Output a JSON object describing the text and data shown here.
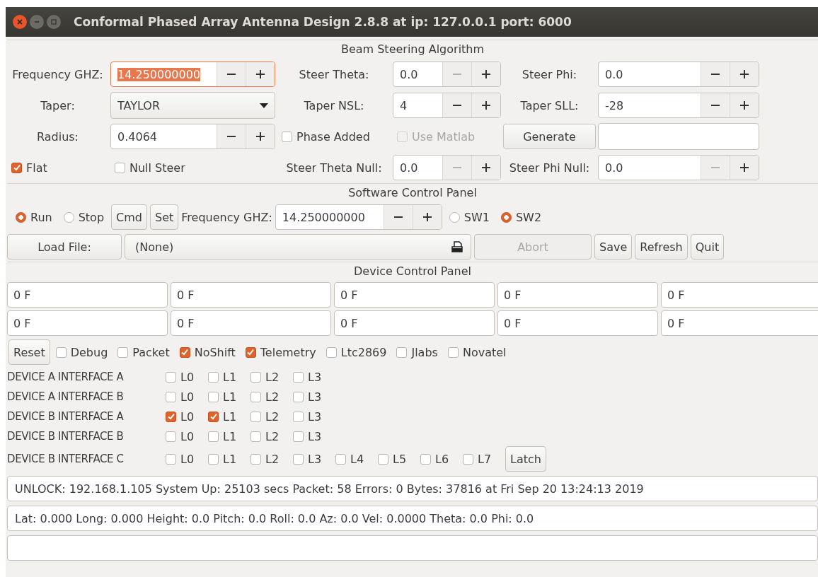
{
  "window": {
    "title": "Conformal Phased Array Antenna Design 2.8.8 at ip: 127.0.0.1 port: 6000"
  },
  "beam_steering": {
    "title": "Beam Steering Algorithm",
    "rows": [
      {
        "items": [
          {
            "kind": "label",
            "text": "Frequency GHZ:"
          },
          {
            "kind": "spin",
            "value": "14.250000000",
            "minus_disabled": false,
            "focused": true
          },
          {
            "kind": "label",
            "text": "Steer Theta:"
          },
          {
            "kind": "spin",
            "value": "0.0",
            "minus_disabled": true,
            "focused": false
          },
          {
            "kind": "label",
            "text": "Steer Phi:"
          },
          {
            "kind": "spin",
            "value": "0.0",
            "minus_disabled": false,
            "focused": false
          }
        ]
      },
      {
        "items": [
          {
            "kind": "label",
            "text": "Taper:"
          },
          {
            "kind": "combo",
            "value": "TAYLOR"
          },
          {
            "kind": "label",
            "text": "Taper NSL:"
          },
          {
            "kind": "spin",
            "value": "4",
            "minus_disabled": false,
            "focused": false
          },
          {
            "kind": "label",
            "text": "Taper SLL:"
          },
          {
            "kind": "spin",
            "value": "-28",
            "minus_disabled": false,
            "focused": false
          }
        ]
      },
      {
        "items": [
          {
            "kind": "label",
            "text": "Radius:"
          },
          {
            "kind": "spin",
            "value": "0.4064",
            "minus_disabled": false,
            "focused": false
          },
          {
            "kind": "check",
            "label": "Phase Added",
            "checked": false,
            "disabled": false
          },
          {
            "kind": "check",
            "label": "Use Matlab",
            "checked": false,
            "disabled": true
          },
          {
            "kind": "button",
            "label": "Generate",
            "disabled": false
          },
          {
            "kind": "entry"
          }
        ]
      },
      {
        "items": [
          {
            "kind": "check",
            "label": "Flat",
            "checked": true,
            "disabled": false
          },
          {
            "kind": "check",
            "label": "Null Steer",
            "checked": false,
            "disabled": false
          },
          {
            "kind": "label",
            "text": "Steer Theta Null:"
          },
          {
            "kind": "spin",
            "value": "0.0",
            "minus_disabled": true,
            "focused": false
          },
          {
            "kind": "label",
            "text": "Steer Phi Null:"
          },
          {
            "kind": "spin",
            "value": "0.0",
            "minus_disabled": true,
            "focused": false
          }
        ]
      }
    ]
  },
  "software_control": {
    "title": "Software Control Panel",
    "rows": [
      {
        "items": [
          {
            "kind": "radio",
            "label": "Run",
            "selected": true
          },
          {
            "kind": "radio",
            "label": "Stop",
            "selected": false
          },
          {
            "kind": "button",
            "label": "Cmd",
            "disabled": false
          },
          {
            "kind": "button",
            "label": "Set",
            "disabled": false
          },
          {
            "kind": "label",
            "text": "Frequency GHZ:"
          },
          {
            "kind": "spin",
            "value": "14.250000000",
            "minus_disabled": false,
            "focused": false
          },
          {
            "kind": "radio",
            "label": "SW1",
            "selected": false
          },
          {
            "kind": "radio",
            "label": "SW2",
            "selected": true
          }
        ]
      },
      {
        "items": [
          {
            "kind": "button",
            "label": "Load File:",
            "disabled": false
          },
          {
            "kind": "file",
            "value": "(None)"
          },
          {
            "kind": "button",
            "label": "Abort",
            "disabled": true
          },
          {
            "kind": "button",
            "label": "Save",
            "disabled": false
          },
          {
            "kind": "button",
            "label": "Refresh",
            "disabled": false
          },
          {
            "kind": "button",
            "label": "Quit",
            "disabled": false
          }
        ]
      }
    ]
  },
  "device_control": {
    "title": "Device Control Panel",
    "rows": [
      {
        "items": [
          {
            "kind": "entry",
            "value": "0 F"
          },
          {
            "kind": "entry",
            "value": "0 F"
          },
          {
            "kind": "entry",
            "value": "0 F"
          },
          {
            "kind": "entry",
            "value": "0 F"
          },
          {
            "kind": "entry",
            "value": "0 F"
          }
        ]
      },
      {
        "items": [
          {
            "kind": "entry",
            "value": "0 F"
          },
          {
            "kind": "entry",
            "value": "0 F"
          },
          {
            "kind": "entry",
            "value": "0 F"
          },
          {
            "kind": "entry",
            "value": "0 F"
          },
          {
            "kind": "entry",
            "value": "0 F"
          }
        ]
      },
      {
        "items": [
          {
            "kind": "button",
            "label": "Reset",
            "disabled": false
          },
          {
            "kind": "check",
            "label": "Debug",
            "checked": false
          },
          {
            "kind": "check",
            "label": "Packet",
            "checked": false
          },
          {
            "kind": "check",
            "label": "NoShift",
            "checked": true
          },
          {
            "kind": "check",
            "label": "Telemetry",
            "checked": true
          },
          {
            "kind": "check",
            "label": "Ltc2869",
            "checked": false
          },
          {
            "kind": "check",
            "label": "Jlabs",
            "checked": false
          },
          {
            "kind": "check",
            "label": "Novatel",
            "checked": false
          }
        ]
      },
      {
        "items": [
          {
            "kind": "label",
            "text": "DEVICE A INTERFACE A"
          },
          {
            "kind": "check",
            "label": "L0",
            "checked": false
          },
          {
            "kind": "check",
            "label": "L1",
            "checked": false
          },
          {
            "kind": "check",
            "label": "L2",
            "checked": false
          },
          {
            "kind": "check",
            "label": "L3",
            "checked": false
          }
        ]
      },
      {
        "items": [
          {
            "kind": "label",
            "text": "DEVICE A INTERFACE B"
          },
          {
            "kind": "check",
            "label": "L0",
            "checked": false
          },
          {
            "kind": "check",
            "label": "L1",
            "checked": false
          },
          {
            "kind": "check",
            "label": "L2",
            "checked": false
          },
          {
            "kind": "check",
            "label": "L3",
            "checked": false
          }
        ]
      },
      {
        "items": [
          {
            "kind": "label",
            "text": "DEVICE B INTERFACE A"
          },
          {
            "kind": "check",
            "label": "L0",
            "checked": true
          },
          {
            "kind": "check",
            "label": "L1",
            "checked": true
          },
          {
            "kind": "check",
            "label": "L2",
            "checked": false
          },
          {
            "kind": "check",
            "label": "L3",
            "checked": false
          }
        ]
      },
      {
        "items": [
          {
            "kind": "label",
            "text": "DEVICE B INTERFACE B"
          },
          {
            "kind": "check",
            "label": "L0",
            "checked": false
          },
          {
            "kind": "check",
            "label": "L1",
            "checked": false
          },
          {
            "kind": "check",
            "label": "L2",
            "checked": false
          },
          {
            "kind": "check",
            "label": "L3",
            "checked": false
          }
        ]
      },
      {
        "items": [
          {
            "kind": "label",
            "text": "DEVICE B INTERFACE C"
          },
          {
            "kind": "check",
            "label": "L0",
            "checked": false
          },
          {
            "kind": "check",
            "label": "L1",
            "checked": false
          },
          {
            "kind": "check",
            "label": "L2",
            "checked": false
          },
          {
            "kind": "check",
            "label": "L3",
            "checked": false
          },
          {
            "kind": "check",
            "label": "L4",
            "checked": false
          },
          {
            "kind": "check",
            "label": "L5",
            "checked": false
          },
          {
            "kind": "check",
            "label": "L6",
            "checked": false
          },
          {
            "kind": "check",
            "label": "L7",
            "checked": false
          },
          {
            "kind": "button",
            "label": "Latch",
            "disabled": false
          }
        ]
      }
    ]
  },
  "status_fields": [
    "UNLOCK: 192.168.1.105 System Up: 25103 secs Packet: 58 Errors: 0 Bytes: 37816 at Fri Sep 20 13:24:13 2019",
    "Lat: 0.000 Long: 0.000 Height: 0.0 Pitch: 0.0 Roll: 0.0 Az: 0.0 Vel: 0.0000 Theta: 0.0 Phi: 0.0"
  ]
}
